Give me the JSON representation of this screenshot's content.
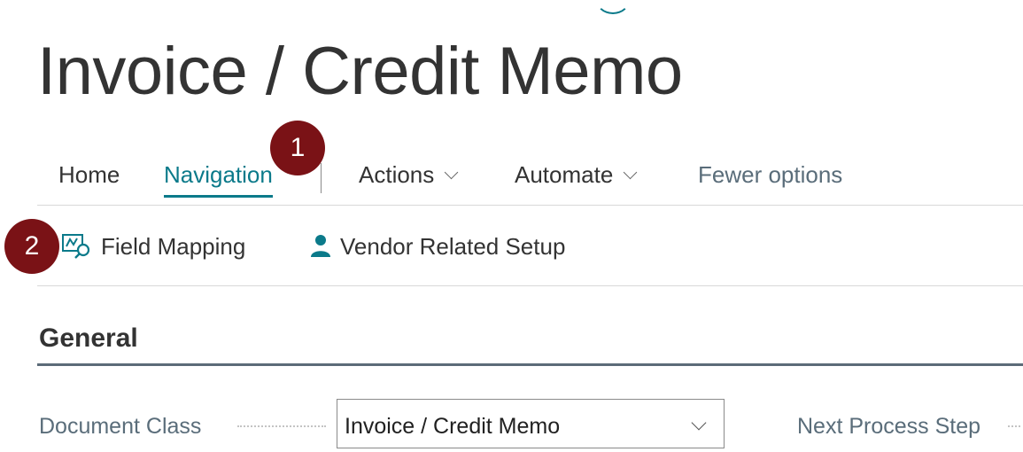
{
  "page": {
    "title": "Invoice / Credit Memo"
  },
  "action_bar": {
    "items": [
      {
        "label": "Home"
      },
      {
        "label": "Navigation"
      },
      {
        "label": "Actions"
      },
      {
        "label": "Automate"
      },
      {
        "label": "Fewer options"
      }
    ],
    "active": "Navigation"
  },
  "promoted_actions": {
    "items": [
      {
        "label": "Field Mapping",
        "icon": "field-mapping-icon"
      },
      {
        "label": "Vendor Related Setup",
        "icon": "person-icon"
      }
    ]
  },
  "section": {
    "title": "General"
  },
  "fields": {
    "document_class": {
      "label": "Document Class",
      "value": "Invoice / Credit Memo"
    },
    "next_process_step": {
      "label": "Next Process Step"
    }
  },
  "badges": [
    "1",
    "2"
  ],
  "colors": {
    "accent": "#0b7a8a",
    "badge": "#7a1216",
    "text": "#333333",
    "muted": "#5a6d7a"
  }
}
